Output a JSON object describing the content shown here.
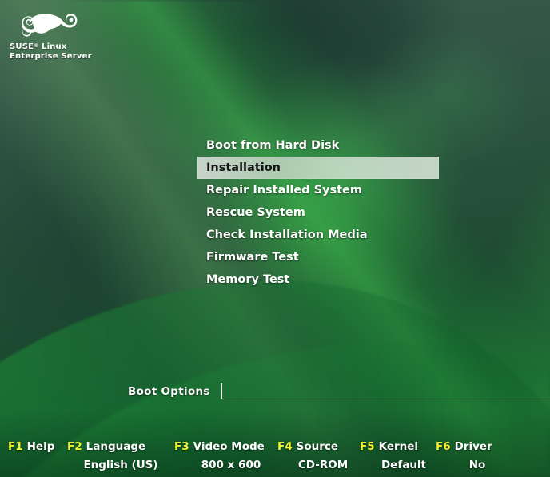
{
  "brand": {
    "logo_icon": "suse-chameleon-logo",
    "line1": "SUSE",
    "trademark": "®",
    "line1_suffix": " Linux",
    "line2": "Enterprise Server"
  },
  "boot_menu": {
    "items": [
      {
        "label": "Boot from Hard Disk",
        "selected": false
      },
      {
        "label": "Installation",
        "selected": true
      },
      {
        "label": "Repair Installed System",
        "selected": false
      },
      {
        "label": "Rescue System",
        "selected": false
      },
      {
        "label": "Check Installation Media",
        "selected": false
      },
      {
        "label": "Firmware Test",
        "selected": false
      },
      {
        "label": "Memory Test",
        "selected": false
      }
    ],
    "selected_index": 1
  },
  "boot_options": {
    "label": "Boot Options",
    "value": "",
    "placeholder": ""
  },
  "function_keys": [
    {
      "key": "F1",
      "name": "Help",
      "value": ""
    },
    {
      "key": "F2",
      "name": "Language",
      "value": "English (US)"
    },
    {
      "key": "F3",
      "name": "Video Mode",
      "value": "800 x 600"
    },
    {
      "key": "F4",
      "name": "Source",
      "value": "CD-ROM"
    },
    {
      "key": "F5",
      "name": "Kernel",
      "value": "Default"
    },
    {
      "key": "F6",
      "name": "Driver",
      "value": "No"
    }
  ],
  "colors": {
    "fkey_label": "#f3f336",
    "text": "#ffffff",
    "selected_text": "#141414",
    "background_green": "#25503c",
    "accent_green": "#3ec64c"
  }
}
